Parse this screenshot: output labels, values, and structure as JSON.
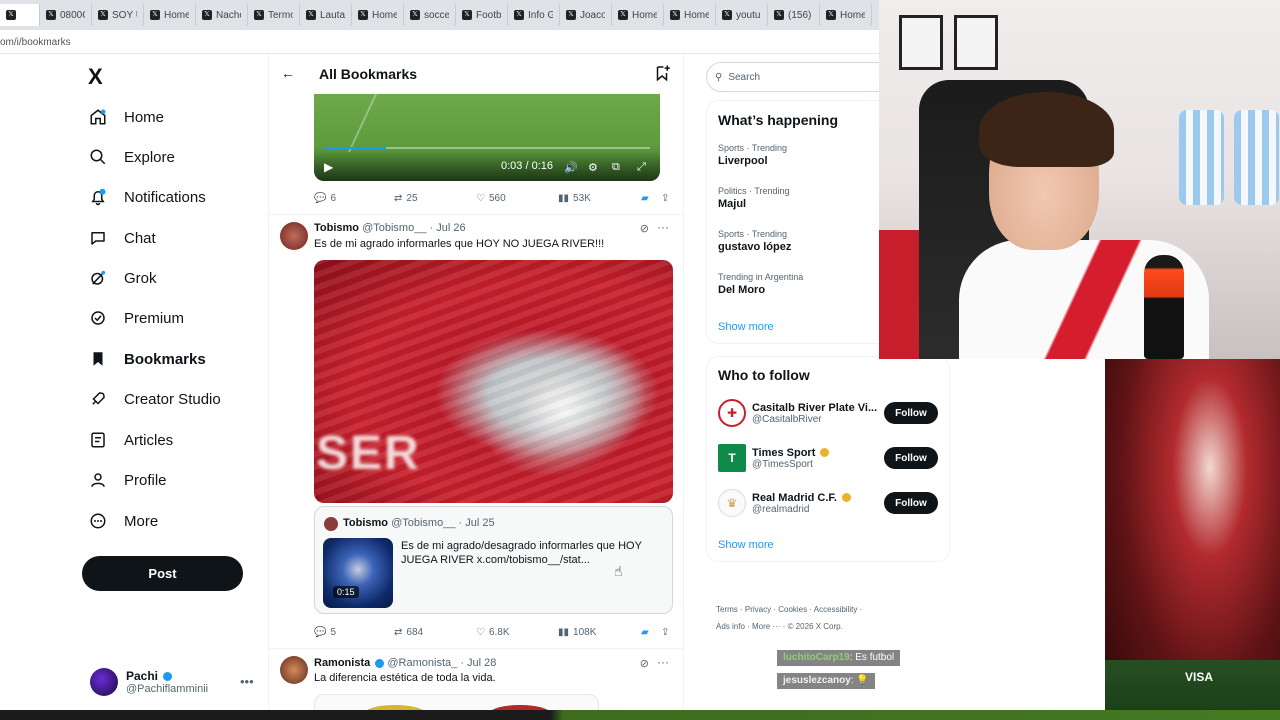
{
  "browser": {
    "tabs": [
      "",
      "0800Cl",
      "SOY UN",
      "Home",
      "Nacho",
      "Termon",
      "Lautaro",
      "Home",
      "soccer",
      "Footbal",
      "Info Ge",
      "Joaco",
      "Home",
      "Home",
      "youtub",
      "(156)",
      "Home"
    ],
    "url": "om/i/bookmarks"
  },
  "nav": {
    "logo": "X",
    "items": [
      {
        "label": "Home",
        "icon": "home-icon"
      },
      {
        "label": "Explore",
        "icon": "search-icon"
      },
      {
        "label": "Notifications",
        "icon": "bell-icon"
      },
      {
        "label": "Chat",
        "icon": "chat-icon"
      },
      {
        "label": "Grok",
        "icon": "grok-icon"
      },
      {
        "label": "Premium",
        "icon": "premium-icon"
      },
      {
        "label": "Bookmarks",
        "icon": "bookmark-icon"
      },
      {
        "label": "Creator Studio",
        "icon": "rocket-icon"
      },
      {
        "label": "Articles",
        "icon": "article-icon"
      },
      {
        "label": "Profile",
        "icon": "person-icon"
      },
      {
        "label": "More",
        "icon": "more-circle-icon"
      }
    ],
    "post_label": "Post",
    "user": {
      "name": "Pachi",
      "handle": "@Pachiflamminii"
    }
  },
  "header": {
    "title": "All Bookmarks"
  },
  "video_top": {
    "time": "0:03 / 0:16",
    "progress": 0.19,
    "stats": {
      "replies": "6",
      "reposts": "25",
      "likes": "560",
      "views": "53K"
    }
  },
  "tweet1": {
    "name": "Tobismo",
    "handle": "@Tobismo__",
    "date": "· Jul 26",
    "text": "Es de mi agrado informarles que HOY NO JUEGA RIVER!!!",
    "media_text": "SER",
    "quote": {
      "name": "Tobismo",
      "handle": "@Tobismo__",
      "date": "· Jul 25",
      "text": "Es de mi agrado/desagrado informarles que HOY JUEGA RIVER   x.com/tobismo__/stat...",
      "duration": "0:15"
    },
    "stats": {
      "replies": "5",
      "reposts": "684",
      "likes": "6.8K",
      "views": "108K"
    }
  },
  "tweet2": {
    "name": "Ramonista",
    "handle": "@Ramonista_",
    "date": "· Jul 28",
    "text": "La diferencia estética de toda la vida."
  },
  "right": {
    "search_placeholder": "Search",
    "happening_title": "What’s happening",
    "trends": [
      {
        "context": "Sports · Trending",
        "title": "Liverpool"
      },
      {
        "context": "Politics · Trending",
        "title": "Majul"
      },
      {
        "context": "Sports · Trending",
        "title": "gustavo lópez"
      },
      {
        "context": "Trending in Argentina",
        "title": "Del Moro"
      }
    ],
    "show_more": "Show more",
    "who_title": "Who to follow",
    "follow": [
      {
        "name": "Casitalb River Plate Vi...",
        "handle": "@CasitalbRiver"
      },
      {
        "name": "Times Sport",
        "handle": "@TimesSport"
      },
      {
        "name": "Real Madrid C.F.",
        "handle": "@realmadrid"
      }
    ],
    "follow_label": "Follow",
    "footer1": "Terms  ·  Privacy  ·  Cookies  ·  Accessibility  ·",
    "footer2": "Ads info  ·  More ···  ·  © 2026 X Corp."
  },
  "stream_chat": [
    {
      "user": "luchitoCarp19",
      "msg": ": Es futbol"
    },
    {
      "user": "jesuslezcanoy",
      "msg": ": 💡"
    }
  ],
  "stadium_ad": "VISA",
  "colors": {
    "accent": "#1d9bf0",
    "text": "#0f1419",
    "muted": "#536471",
    "river_red": "#c8202c"
  }
}
